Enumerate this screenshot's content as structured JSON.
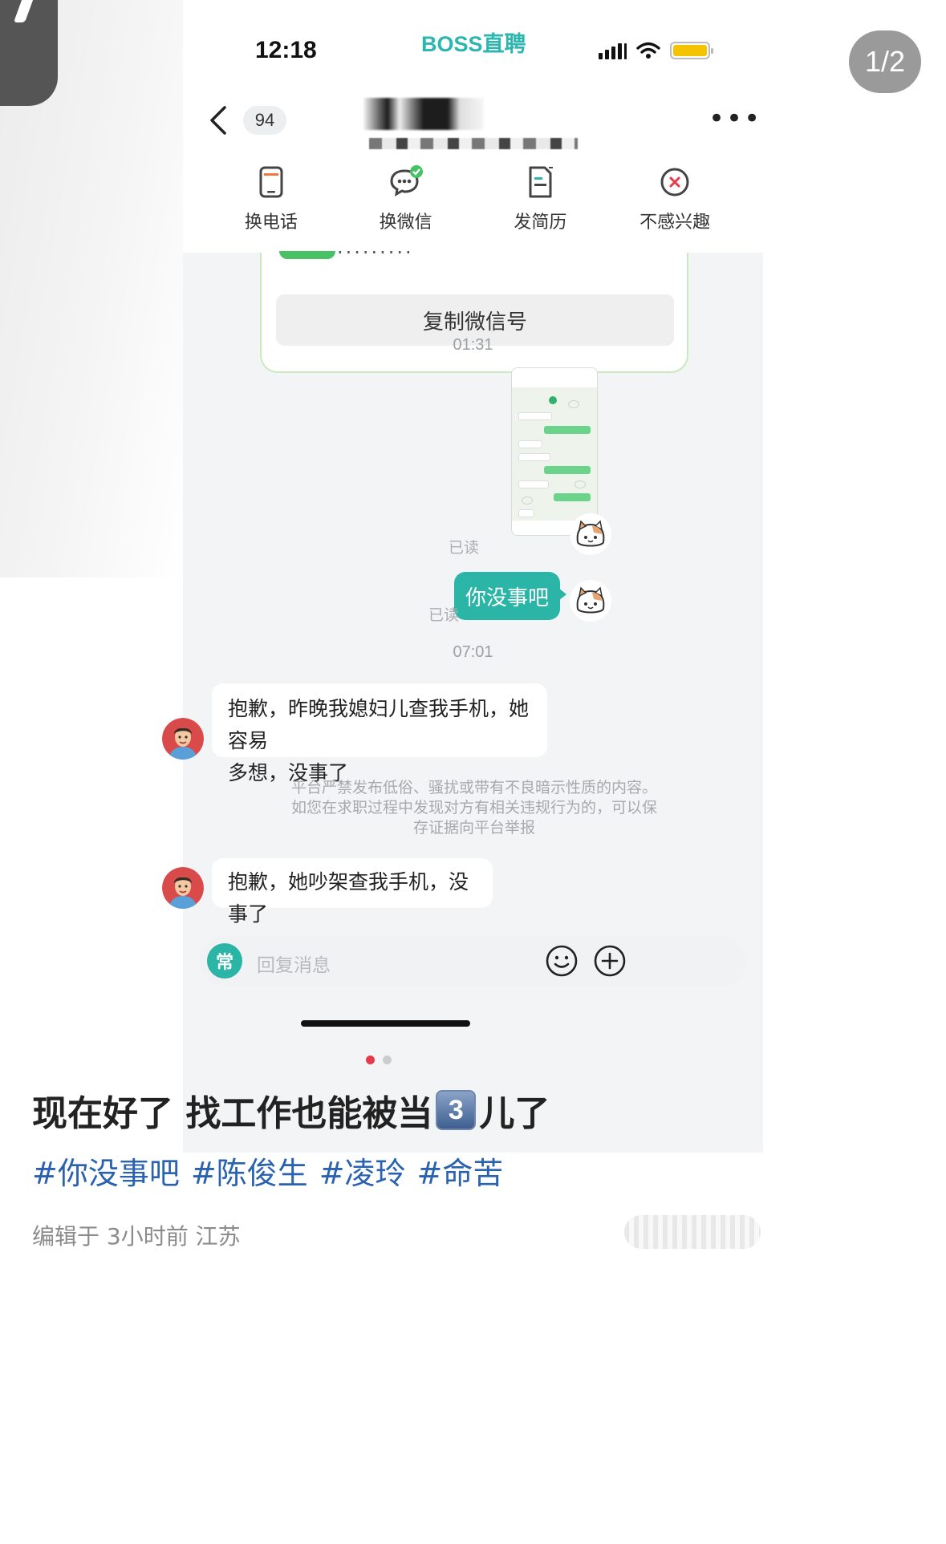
{
  "image_counter": "1/2",
  "phone": {
    "status": {
      "time": "12:18",
      "brand": "BOSS直聘"
    },
    "nav": {
      "unread_count": "94"
    },
    "actions": [
      {
        "label": "换电话",
        "icon": "phone-card-icon"
      },
      {
        "label": "换微信",
        "icon": "wechat-exchange-icon"
      },
      {
        "label": "发简历",
        "icon": "resume-icon"
      },
      {
        "label": "不感兴趣",
        "icon": "not-interested-icon"
      }
    ],
    "card": {
      "copy_button": "复制微信号"
    },
    "messages": {
      "time1": "01:31",
      "read1": "已读",
      "self_text": "你没事吧",
      "read2": "已读",
      "time2": "07:01",
      "other1_line1": "抱歉，昨晚我媳妇儿查我手机，她容易",
      "other1_line2": "多想，没事了",
      "notice_line1": "平台严禁发布低俗、骚扰或带有不良暗示性质的内容。",
      "notice_line2": "如您在求职过程中发现对方有相关违规行为的，可以保",
      "notice_line3": "存证据向平台举报",
      "other2": "抱歉，她吵架查我手机，没事了"
    },
    "input": {
      "badge": "常",
      "placeholder": "回复消息"
    }
  },
  "carousel": {
    "active_color": "#e8384b",
    "inactive_color": "#cccccc"
  },
  "post": {
    "title_part1": "现在好了 找工作也能被当",
    "title_keycap": "3",
    "title_part2": "儿了",
    "tags": [
      "#你没事吧",
      "#陈俊生",
      "#凌玲",
      "#命苦"
    ],
    "meta": "编辑于 3小时前 江苏"
  }
}
